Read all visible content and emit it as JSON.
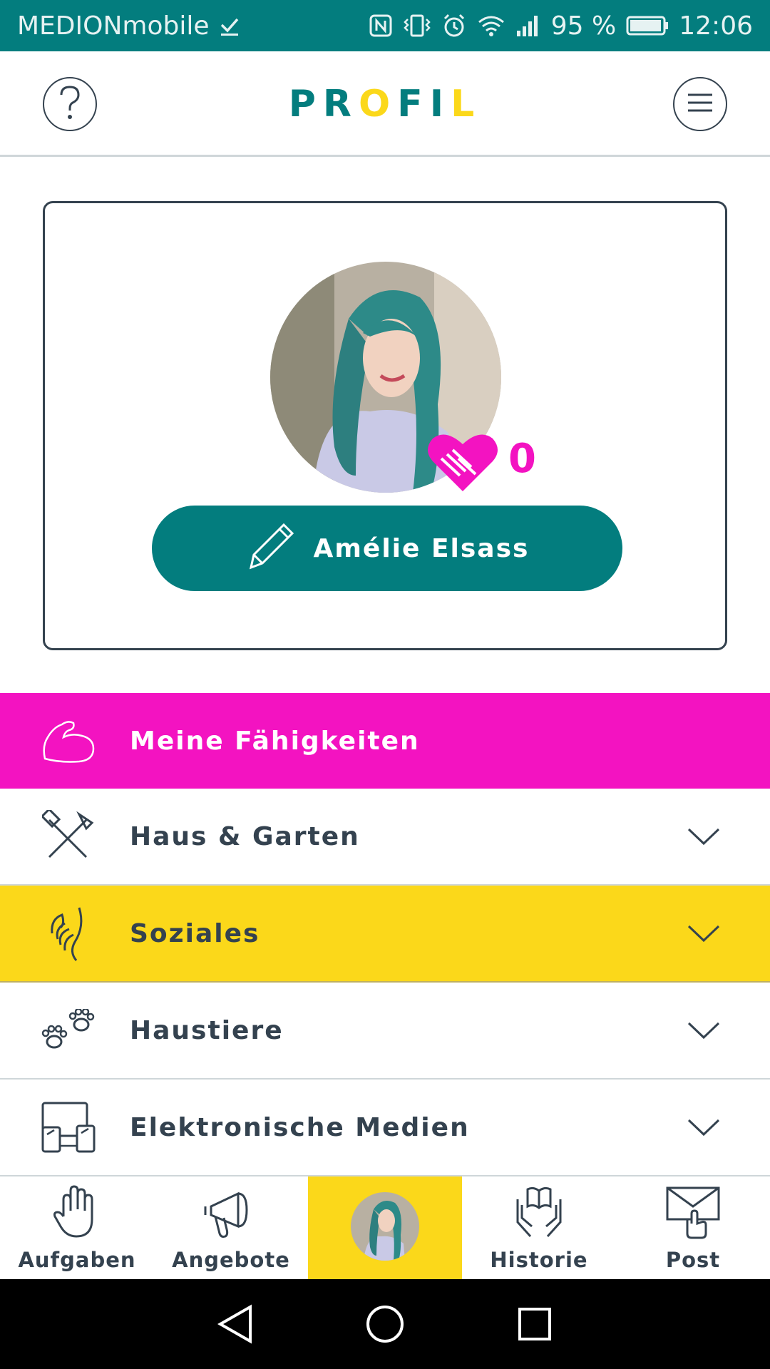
{
  "status_bar": {
    "carrier": "MEDIONmobile",
    "battery": "95 %",
    "time": "12:06"
  },
  "header": {
    "title": "PROFIL"
  },
  "profile": {
    "name": "Amélie Elsass",
    "like_count": "0"
  },
  "skills": {
    "header": "Meine Fähigkeiten",
    "categories": [
      {
        "label": "Haus & Garten",
        "icon": "tools-icon"
      },
      {
        "label": "Soziales",
        "icon": "helping-hands-icon"
      },
      {
        "label": "Haustiere",
        "icon": "paw-icon"
      },
      {
        "label": "Elektronische Medien",
        "icon": "devices-icon"
      }
    ]
  },
  "bottom_nav": {
    "items": [
      {
        "label": "Aufgaben",
        "icon": "hand-icon"
      },
      {
        "label": "Angebote",
        "icon": "megaphone-icon"
      },
      {
        "label": "",
        "icon": "profile-avatar"
      },
      {
        "label": "Historie",
        "icon": "book-hands-icon"
      },
      {
        "label": "Post",
        "icon": "envelope-icon"
      }
    ]
  },
  "colors": {
    "teal": "#037d7e",
    "magenta": "#f313c1",
    "yellow": "#fbd81a",
    "text": "#34424f"
  }
}
